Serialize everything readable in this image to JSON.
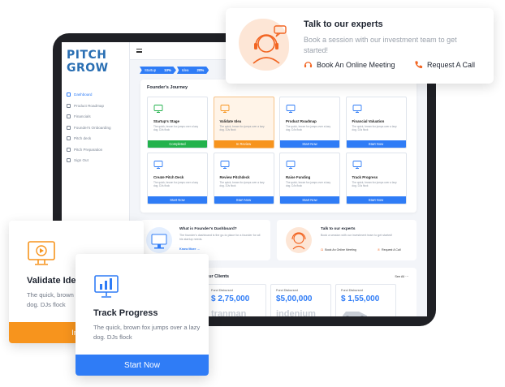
{
  "colors": {
    "brand_blue": "#2f7cf6",
    "orange": "#f7941d",
    "green": "#22b24c",
    "accent_red": "#f26522"
  },
  "logo": {
    "line1": "PITCH",
    "line2": "GROW"
  },
  "sidebar": {
    "items": [
      {
        "label": "Dashboard",
        "icon": "dashboard-icon"
      },
      {
        "label": "Product Roadmap",
        "icon": "roadmap-icon"
      },
      {
        "label": "Financials",
        "icon": "financials-icon"
      },
      {
        "label": "Founder's Onboarding",
        "icon": "onboarding-icon"
      },
      {
        "label": "Pitch deck",
        "icon": "pitchdeck-icon"
      },
      {
        "label": "Pitch Preparation",
        "icon": "preparation-icon"
      },
      {
        "label": "Sign Out",
        "icon": "signout-icon"
      }
    ]
  },
  "steps": [
    {
      "name": "Startup",
      "pct": "10%"
    },
    {
      "name": "Idea",
      "pct": "20%"
    }
  ],
  "journey": {
    "title": "Founder's Journey",
    "cards": [
      {
        "title": "Startup's Stage",
        "desc": "The quick, brown fox jumps over a lazy dog. DJs flock",
        "action": "Completed",
        "state": "green",
        "icon": "startup-stage-icon"
      },
      {
        "title": "Validate Idea",
        "desc": "The quick, brown fox jumps over a lazy dog. DJs flock",
        "action": "In Review",
        "state": "orange",
        "icon": "validate-idea-icon"
      },
      {
        "title": "Product Roadmap",
        "desc": "The quick, brown fox jumps over a lazy dog. DJs flock",
        "action": "Start Now",
        "state": "blue",
        "icon": "roadmap-chart-icon"
      },
      {
        "title": "Financial Valuation",
        "desc": "The quick, brown fox jumps over a lazy dog. DJs flock",
        "action": "Start Now",
        "state": "blue",
        "icon": "dollar-icon"
      },
      {
        "title": "Create Pitch Deck",
        "desc": "The quick, brown fox jumps over a lazy dog. DJs flock",
        "action": "Start Now",
        "state": "blue",
        "icon": "create-deck-icon"
      },
      {
        "title": "Review Pitchdeck",
        "desc": "The quick, brown fox jumps over a lazy dog. DJs flock",
        "action": "Start Now",
        "state": "blue",
        "icon": "review-deck-icon"
      },
      {
        "title": "Raise Funding",
        "desc": "The quick, brown fox jumps over a lazy dog. DJs flock",
        "action": "Start Now",
        "state": "blue",
        "icon": "funding-icon"
      },
      {
        "title": "Track Progress",
        "desc": "The quick, brown fox jumps over a lazy dog. DJs flock",
        "action": "Start Now",
        "state": "blue",
        "icon": "progress-icon"
      }
    ]
  },
  "info": {
    "left_title": "What is Founder's Dashboard?",
    "left_desc": "The founder's dashboard is the go-to place for a founder for all his startup needs.",
    "left_link": "Know More",
    "right_title": "Talk to our experts",
    "right_desc": "Book a session with our investment team to get started!",
    "right_link1": "Book An Online Meeting",
    "right_link2": "Request A Call"
  },
  "clients": {
    "title": "Our Clients",
    "see_all": "See All",
    "items": [
      {
        "label": "Fund Disbursed",
        "value": "$ 2,75,000",
        "watermark": "tranman"
      },
      {
        "label": "Fund Disbursed",
        "value": "$5,00,000",
        "watermark": "indenium"
      },
      {
        "label": "Fund Disbursed",
        "value": "$ 1,55,000",
        "watermark": ""
      }
    ]
  },
  "expert_popup": {
    "title": "Talk to our experts",
    "desc": "Book a session with our investment team to get started!",
    "meeting": "Book An Online Meeting",
    "call": "Request A Call"
  },
  "validate_card": {
    "title": "Validate Idea",
    "desc": "The quick, brown fox jumps over a lazy dog. DJs flock",
    "action": "In Review"
  },
  "track_card": {
    "title": "Track Progress",
    "desc": "The quick, brown fox jumps over a lazy dog. DJs flock",
    "action": "Start Now"
  }
}
